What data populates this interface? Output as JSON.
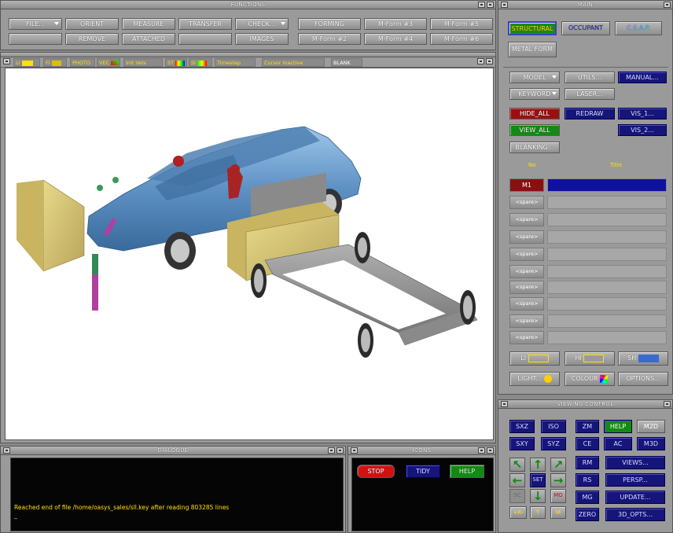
{
  "functions": {
    "title": "FUNCTIONS",
    "buttons_row1": [
      "FILE...",
      "ORIENT",
      "MEASURE",
      "TRANSFER",
      "CHECK...",
      "FORMING",
      "M-Form #3",
      "M-Form #5"
    ],
    "buttons_row2": [
      "REMOVE",
      "ATTACHED",
      "IMAGES",
      "M-Form #2",
      "M-Form #4",
      "M-Form #6"
    ]
  },
  "viewer": {
    "toolbar": [
      "LI",
      "FI",
      "PHOTO",
      "VEC",
      "Init Vels",
      "ST",
      "SI",
      "Timestep",
      "Cursor Inactive",
      "BLANK"
    ]
  },
  "main": {
    "title": "MAIN",
    "modes": [
      "STRUCTURAL",
      "OCCUPANT",
      "C.E.A.P.",
      "METAL FORM"
    ],
    "row_model": [
      "MODEL",
      "UTILS...",
      "MANUAL..."
    ],
    "row_keyword": [
      "KEYWORD",
      "LASER..."
    ],
    "row_hide": [
      "HIDE_ALL",
      "REDRAW",
      "VIS_1..."
    ],
    "row_view": [
      "VIEW_ALL",
      "VIS_2..."
    ],
    "blanking": "BLANKING...",
    "table_headers": [
      "No",
      "Title"
    ],
    "models": [
      {
        "no": "M1",
        "title": ""
      },
      {
        "no": "<spare>",
        "title": ""
      },
      {
        "no": "<spare>",
        "title": ""
      },
      {
        "no": "<spare>",
        "title": ""
      },
      {
        "no": "<spare>",
        "title": ""
      },
      {
        "no": "<spare>",
        "title": ""
      },
      {
        "no": "<spare>",
        "title": ""
      },
      {
        "no": "<spare>",
        "title": ""
      },
      {
        "no": "<spare>",
        "title": ""
      },
      {
        "no": "<spare>",
        "title": ""
      }
    ],
    "render_buttons": [
      "LI",
      "HI",
      "SH"
    ],
    "bottom_buttons": [
      "LIGHT...",
      "COLOUR",
      "OPTIONS..."
    ]
  },
  "viewing_control": {
    "title": "VIEWING CONTROL",
    "views": [
      "SXZ",
      "ISO",
      "SXY",
      "SYZ"
    ],
    "center_set": "SET",
    "sc": "SC",
    "mo": "MO",
    "rot_labels": [
      "+R-",
      "T",
      "M"
    ],
    "zoom_col1": [
      "ZM",
      "CE",
      "RM",
      "RS",
      "MG",
      "ZERO"
    ],
    "zoom_col2": [
      "HELP",
      "AC"
    ],
    "m2d": "M2D",
    "m3d": "M3D",
    "right_col": [
      "VIEWS...",
      "PERSP...",
      "UPDATE...",
      "3D_OPTS..."
    ]
  },
  "dialogue": {
    "title": "DIALOGUE",
    "message": "Reached end of file /home/oasys_sales/sll.key after reading 803285 lines",
    "prompt": "_"
  },
  "icons": {
    "title": "ICONS",
    "stop": "STOP",
    "tidy": "TIDY",
    "help": "HELP"
  }
}
